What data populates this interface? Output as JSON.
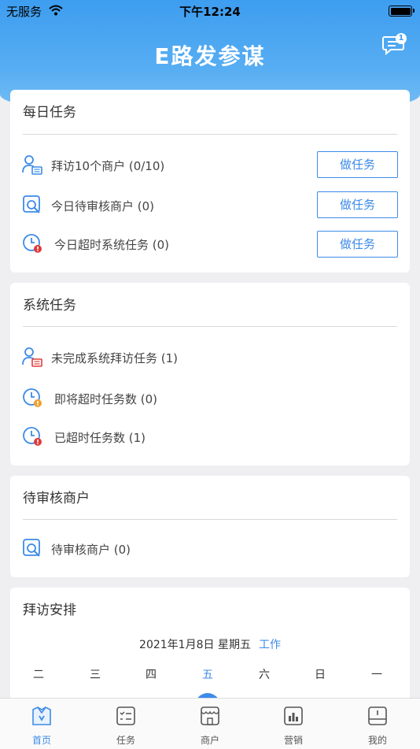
{
  "status_bar": {
    "carrier": "无服务",
    "time": "下午12:24"
  },
  "header": {
    "title": "E路发参谋",
    "message_badge": "1"
  },
  "daily_tasks": {
    "title": "每日任务",
    "button_label": "做任务",
    "items": [
      {
        "label": "拜访10个商户 (0/10)",
        "icon": "visit-user-icon"
      },
      {
        "label": "今日待审核商户 (0)",
        "icon": "review-search-icon"
      },
      {
        "label": "今日超时系统任务 (0)",
        "icon": "clock-alert-icon"
      }
    ]
  },
  "system_tasks": {
    "title": "系统任务",
    "items": [
      {
        "label": "未完成系统拜访任务 (1)",
        "icon": "visit-user-icon"
      },
      {
        "label": "即将超时任务数 (0)",
        "icon": "clock-warning-icon"
      },
      {
        "label": "已超时任务数 (1)",
        "icon": "clock-alert-icon"
      }
    ]
  },
  "pending_merchants": {
    "title": "待审核商户",
    "items": [
      {
        "label": "待审核商户 (0)",
        "icon": "review-search-icon"
      }
    ]
  },
  "visit_schedule": {
    "title": "拜访安排",
    "date": "2021年1月8日 星期五",
    "day_type": "工作",
    "weekdays": [
      "二",
      "三",
      "四",
      "五",
      "六",
      "日",
      "一"
    ],
    "active_weekday": "五"
  },
  "tabbar": {
    "items": [
      {
        "label": "首页",
        "active": true
      },
      {
        "label": "任务",
        "active": false
      },
      {
        "label": "商户",
        "active": false
      },
      {
        "label": "营销",
        "active": false
      },
      {
        "label": "我的",
        "active": false
      }
    ]
  },
  "colors": {
    "primary": "#3d8be8",
    "header_blue": "#4aa5f1",
    "alert_red": "#e03b3b",
    "warning_orange": "#f0a030"
  }
}
